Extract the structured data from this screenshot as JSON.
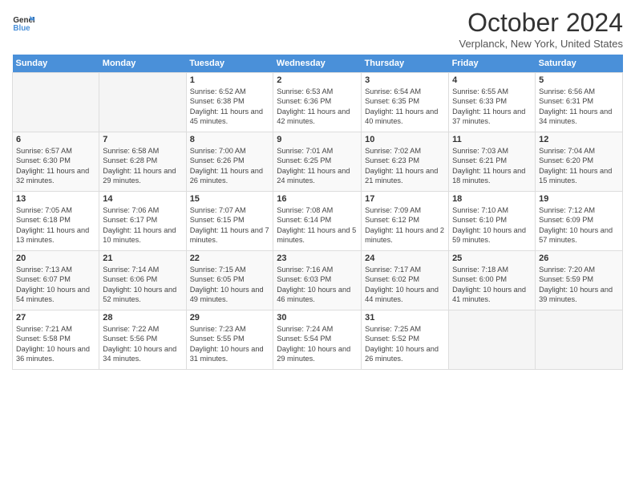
{
  "header": {
    "logo_line1": "General",
    "logo_line2": "Blue",
    "title": "October 2024",
    "subtitle": "Verplanck, New York, United States"
  },
  "days_of_week": [
    "Sunday",
    "Monday",
    "Tuesday",
    "Wednesday",
    "Thursday",
    "Friday",
    "Saturday"
  ],
  "weeks": [
    [
      {
        "day": "",
        "info": ""
      },
      {
        "day": "",
        "info": ""
      },
      {
        "day": "1",
        "info": "Sunrise: 6:52 AM\nSunset: 6:38 PM\nDaylight: 11 hours and 45 minutes."
      },
      {
        "day": "2",
        "info": "Sunrise: 6:53 AM\nSunset: 6:36 PM\nDaylight: 11 hours and 42 minutes."
      },
      {
        "day": "3",
        "info": "Sunrise: 6:54 AM\nSunset: 6:35 PM\nDaylight: 11 hours and 40 minutes."
      },
      {
        "day": "4",
        "info": "Sunrise: 6:55 AM\nSunset: 6:33 PM\nDaylight: 11 hours and 37 minutes."
      },
      {
        "day": "5",
        "info": "Sunrise: 6:56 AM\nSunset: 6:31 PM\nDaylight: 11 hours and 34 minutes."
      }
    ],
    [
      {
        "day": "6",
        "info": "Sunrise: 6:57 AM\nSunset: 6:30 PM\nDaylight: 11 hours and 32 minutes."
      },
      {
        "day": "7",
        "info": "Sunrise: 6:58 AM\nSunset: 6:28 PM\nDaylight: 11 hours and 29 minutes."
      },
      {
        "day": "8",
        "info": "Sunrise: 7:00 AM\nSunset: 6:26 PM\nDaylight: 11 hours and 26 minutes."
      },
      {
        "day": "9",
        "info": "Sunrise: 7:01 AM\nSunset: 6:25 PM\nDaylight: 11 hours and 24 minutes."
      },
      {
        "day": "10",
        "info": "Sunrise: 7:02 AM\nSunset: 6:23 PM\nDaylight: 11 hours and 21 minutes."
      },
      {
        "day": "11",
        "info": "Sunrise: 7:03 AM\nSunset: 6:21 PM\nDaylight: 11 hours and 18 minutes."
      },
      {
        "day": "12",
        "info": "Sunrise: 7:04 AM\nSunset: 6:20 PM\nDaylight: 11 hours and 15 minutes."
      }
    ],
    [
      {
        "day": "13",
        "info": "Sunrise: 7:05 AM\nSunset: 6:18 PM\nDaylight: 11 hours and 13 minutes."
      },
      {
        "day": "14",
        "info": "Sunrise: 7:06 AM\nSunset: 6:17 PM\nDaylight: 11 hours and 10 minutes."
      },
      {
        "day": "15",
        "info": "Sunrise: 7:07 AM\nSunset: 6:15 PM\nDaylight: 11 hours and 7 minutes."
      },
      {
        "day": "16",
        "info": "Sunrise: 7:08 AM\nSunset: 6:14 PM\nDaylight: 11 hours and 5 minutes."
      },
      {
        "day": "17",
        "info": "Sunrise: 7:09 AM\nSunset: 6:12 PM\nDaylight: 11 hours and 2 minutes."
      },
      {
        "day": "18",
        "info": "Sunrise: 7:10 AM\nSunset: 6:10 PM\nDaylight: 10 hours and 59 minutes."
      },
      {
        "day": "19",
        "info": "Sunrise: 7:12 AM\nSunset: 6:09 PM\nDaylight: 10 hours and 57 minutes."
      }
    ],
    [
      {
        "day": "20",
        "info": "Sunrise: 7:13 AM\nSunset: 6:07 PM\nDaylight: 10 hours and 54 minutes."
      },
      {
        "day": "21",
        "info": "Sunrise: 7:14 AM\nSunset: 6:06 PM\nDaylight: 10 hours and 52 minutes."
      },
      {
        "day": "22",
        "info": "Sunrise: 7:15 AM\nSunset: 6:05 PM\nDaylight: 10 hours and 49 minutes."
      },
      {
        "day": "23",
        "info": "Sunrise: 7:16 AM\nSunset: 6:03 PM\nDaylight: 10 hours and 46 minutes."
      },
      {
        "day": "24",
        "info": "Sunrise: 7:17 AM\nSunset: 6:02 PM\nDaylight: 10 hours and 44 minutes."
      },
      {
        "day": "25",
        "info": "Sunrise: 7:18 AM\nSunset: 6:00 PM\nDaylight: 10 hours and 41 minutes."
      },
      {
        "day": "26",
        "info": "Sunrise: 7:20 AM\nSunset: 5:59 PM\nDaylight: 10 hours and 39 minutes."
      }
    ],
    [
      {
        "day": "27",
        "info": "Sunrise: 7:21 AM\nSunset: 5:58 PM\nDaylight: 10 hours and 36 minutes."
      },
      {
        "day": "28",
        "info": "Sunrise: 7:22 AM\nSunset: 5:56 PM\nDaylight: 10 hours and 34 minutes."
      },
      {
        "day": "29",
        "info": "Sunrise: 7:23 AM\nSunset: 5:55 PM\nDaylight: 10 hours and 31 minutes."
      },
      {
        "day": "30",
        "info": "Sunrise: 7:24 AM\nSunset: 5:54 PM\nDaylight: 10 hours and 29 minutes."
      },
      {
        "day": "31",
        "info": "Sunrise: 7:25 AM\nSunset: 5:52 PM\nDaylight: 10 hours and 26 minutes."
      },
      {
        "day": "",
        "info": ""
      },
      {
        "day": "",
        "info": ""
      }
    ]
  ]
}
